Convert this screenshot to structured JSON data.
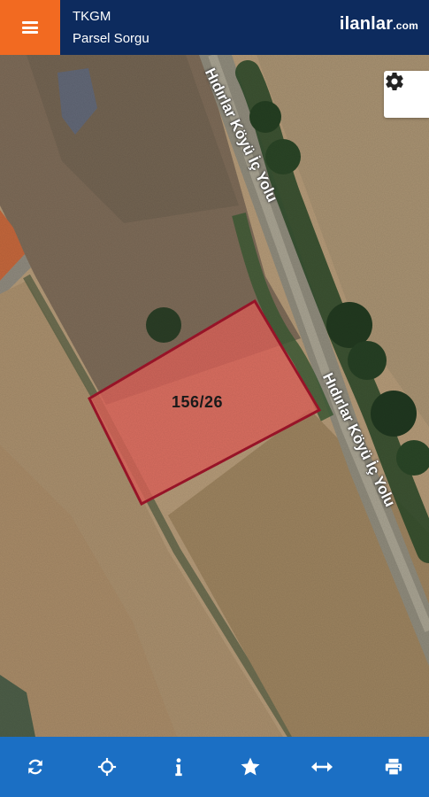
{
  "header": {
    "title": "TKGM",
    "subtitle": "Parsel Sorgu",
    "brand_main": "ilanlar",
    "brand_suffix": ".com"
  },
  "map": {
    "parcel_number": "156/26",
    "road_label_upper": "Hıdırlar Köyü İç Yolu",
    "road_label_lower": "Hıdırlar Köyü İç Yolu",
    "parcel_fill_color": "#e0645a",
    "parcel_border_color": "#a0152a"
  },
  "toolbar": {
    "items": [
      {
        "icon": "refresh-icon"
      },
      {
        "icon": "locate-icon"
      },
      {
        "icon": "info-icon"
      },
      {
        "icon": "star-icon"
      },
      {
        "icon": "measure-icon"
      },
      {
        "icon": "print-icon"
      }
    ]
  },
  "colors": {
    "header_bg": "#0d2b5e",
    "menu_bg": "#f26a21",
    "toolbar_bg": "#1b6fc4"
  }
}
